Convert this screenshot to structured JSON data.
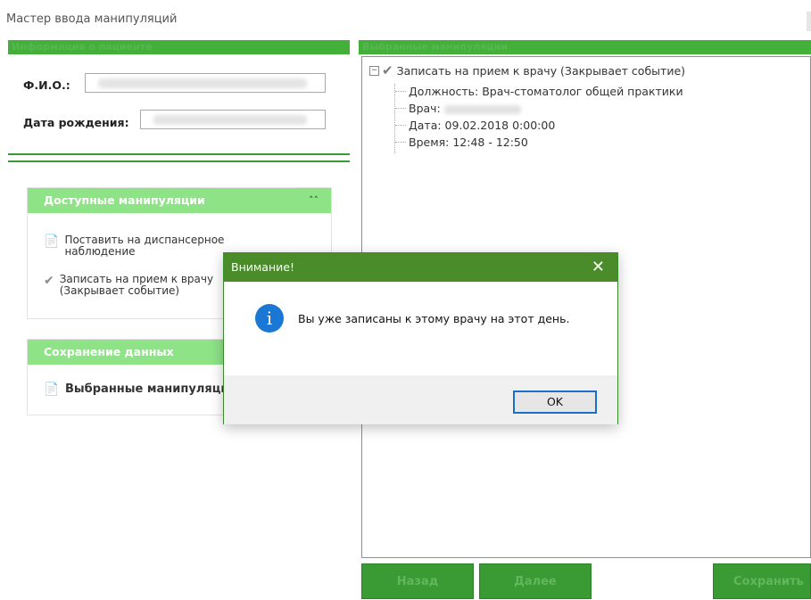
{
  "window": {
    "title": "Мастер ввода манипуляций"
  },
  "patient": {
    "header": "Информация о пациенте",
    "fio_label": "Ф.И.О.:",
    "dob_label": "Дата рождения:"
  },
  "available": {
    "header": "Доступные манипуляции",
    "items": [
      {
        "label": "Поставить на диспансерное наблюдение",
        "icon": "document-icon"
      },
      {
        "label": "Записать на прием к врачу (Закрывает событие)",
        "icon": "check-icon"
      }
    ]
  },
  "save_section": {
    "header": "Сохранение данных",
    "item": "Выбранные манипуляции"
  },
  "selected": {
    "header": "Выбранные манипуляции",
    "root": "Записать на прием к врачу (Закрывает событие)",
    "children": [
      "Должность: Врач-стоматолог общей практики",
      "Врач:",
      "Дата: 09.02.2018 0:00:00",
      "Время: 12:48 - 12:50"
    ]
  },
  "buttons": {
    "back": "Назад",
    "next": "Далее",
    "save": "Сохранить"
  },
  "dialog": {
    "title": "Внимание!",
    "message": "Вы уже записаны к этому врачу на этот день.",
    "ok": "OK"
  },
  "colors": {
    "accent": "#43b03a",
    "section_header": "#8ee387",
    "dialog_title": "#4a8b2a",
    "info": "#1a78d4"
  }
}
